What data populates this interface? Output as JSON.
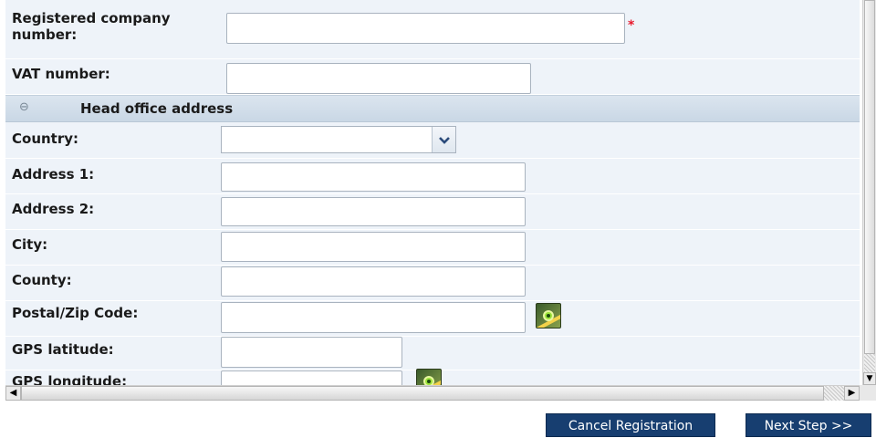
{
  "form": {
    "registered_company_number": {
      "label_line1": "Registered company",
      "label_line2": "number:",
      "value": "",
      "required_mark": "*"
    },
    "vat_number": {
      "label": "VAT number:",
      "value": ""
    }
  },
  "head_office": {
    "section_title": "Head office address",
    "collapse_glyph": "⊖",
    "country": {
      "label": "Country:",
      "value": "",
      "dropdown_glyph": "⌄"
    },
    "address1": {
      "label": "Address 1:",
      "value": ""
    },
    "address2": {
      "label": "Address 2:",
      "value": ""
    },
    "city": {
      "label": "City:",
      "value": ""
    },
    "county": {
      "label": "County:",
      "value": ""
    },
    "postal_code": {
      "label": "Postal/Zip Code:",
      "value": "",
      "lookup_icon": "gps-locate-icon"
    },
    "gps_latitude": {
      "label": "GPS latitude:",
      "value": ""
    },
    "gps_longitude": {
      "label": "GPS longitude:",
      "value": ""
    }
  },
  "scrollbars": {
    "down_arrow": "▼",
    "left_arrow": "◀",
    "right_arrow": "▶"
  },
  "footer": {
    "cancel_label": "Cancel Registration",
    "next_label": "Next Step >>"
  },
  "colors": {
    "panel_bg": "#eef3f9",
    "button_bg": "#173e70",
    "required": "#e8192c"
  }
}
